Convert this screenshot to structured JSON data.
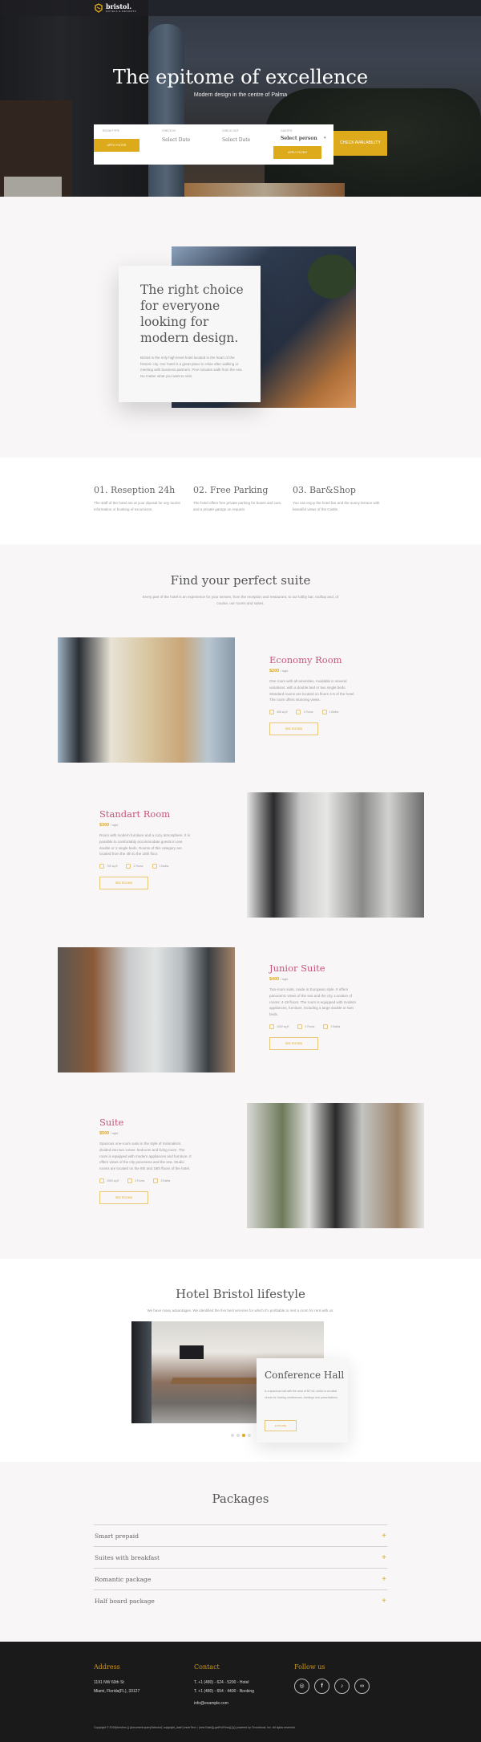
{
  "brand": {
    "name": "bristol.",
    "tagline": "HOTELS & RESORTS"
  },
  "hero": {
    "title": "The epitome of excellence",
    "subtitle": "Modern design in the centre of Palma"
  },
  "booking": {
    "room_type": {
      "label": "Room type",
      "button": "Apply filter"
    },
    "check_in": {
      "label": "Check in",
      "value": "Select Date"
    },
    "check_out": {
      "label": "Check out",
      "value": "Select Date"
    },
    "guests": {
      "label": "Guests",
      "value": "Select person",
      "button": "Apply filter"
    },
    "submit": "Check availability"
  },
  "about": {
    "title": "The right choice for everyone looking for modern design.",
    "text": "Bristol is the only high-level hotel located in the heart of the historic city. Our hotel is a great place to relax after walking or meeting with business partners. Five minutes walk from the sea. No matter what you want to visit."
  },
  "features": [
    {
      "title": "01. Reseption 24h",
      "text": "The staff of the hotel are at your diposal for any tourist information or booking of excursions."
    },
    {
      "title": "02. Free Parking",
      "text": "The hotel offers free private parking for buses and cars, and a private garage on request."
    },
    {
      "title": "03. Bar&Shop",
      "text": "You can enjoy the hotel bar and the sunny terrace with beautiful views of the Castle."
    }
  ],
  "suites": {
    "title": "Find your perfect suite",
    "subtitle": "Every part of the hotel is an experience for your senses, from the reception and restaurant, to our lobby bar, rooftop and, of course, our rooms and suites.",
    "rooms": [
      {
        "name": "Economy Room",
        "price": "$200",
        "per": "/ night",
        "desc": "One room with all amenities. Available in several variations: with a double bed or two single beds. Standard rooms are located on floors 4-5 of the hotel. The room offers stunning views.",
        "area": "405 sq.ft",
        "rooms": "1 Roms",
        "baths": "1 Baths",
        "button": "See rooms"
      },
      {
        "name": "Standart Room",
        "price": "$300",
        "per": "/ night",
        "desc": "Room with modern furniture and a cozy atmosphere. It is possible to comfortably accommodate guests in one double or 2 single beds. Rooms of this category are located from the 4th to the 18th floor.",
        "area": "702 sq.ft",
        "rooms": "1 Roms",
        "baths": "1 Baths",
        "button": "See rooms"
      },
      {
        "name": "Junior Suite",
        "price": "$400",
        "per": "/ night",
        "desc": "Two-room suite, made in European style. It offers panoramic views of the sea and the city. Location of rooms: 4-19 floors. The room is equipped with modern appliances, furniture, including a large double or twin beds.",
        "area": "1002 sq.ft",
        "rooms": "2 Roms",
        "baths": "2 Baths",
        "button": "See rooms"
      },
      {
        "name": "Suite",
        "price": "$500",
        "per": "/ night",
        "desc": "Spacious one-room suite in the style of minimalism, divided into two zones: bedroom and living room. The room is equipped with modern appliances and furniture. It offers views of the city panorama and the sea. Studio rooms are located on the 8th and 19th floors of the hotel.",
        "area": "1500 sq.ft",
        "rooms": "2 Roms",
        "baths": "3 Baths",
        "button": "See rooms"
      }
    ]
  },
  "lifestyle": {
    "title": "Hotel Bristol lifestyle",
    "subtitle": "We have many advantages. We identified the five best services for which it's profitable to rent a room for rent with us:",
    "card": {
      "title": "Conference Hall",
      "text": "Is a spacious hall with the area of 60 m2, which is an ideal venue for hosting conferences, trainings and presentations.",
      "button": "Explore"
    },
    "slides": 4,
    "active_slide": 3
  },
  "packages": {
    "title": "Packages",
    "items": [
      "Smart prepaid",
      "Suites with breakfast",
      "Romantic package",
      "Half board package"
    ]
  },
  "footer": {
    "address": {
      "title": "Address",
      "lines": [
        "1191 NW 60th St",
        "Miami, Florida(FL), 33127"
      ]
    },
    "contact": {
      "title": "Contact",
      "lines": [
        "T. +1 (480) - 624 - 5200 - Hotel",
        "T. +1 (480) - 654 - 4400 - Booking",
        "info@example.com"
      ]
    },
    "follow": {
      "title": "Follow us",
      "icons": [
        "instagram-icon",
        "facebook-icon",
        "tiktok-icon",
        "tripadvisor-icon"
      ]
    },
    "copyright": "Copyright © 2019(function () {document.querySelector('.copyright_date').innerText = (new Date()).getFullYear();})() powered by Crocoblock, Inc. All rights reserved"
  },
  "colors": {
    "accent": "#ddaa1c",
    "room_title": "#c8557a",
    "footer_bg": "#1b1a1b"
  }
}
